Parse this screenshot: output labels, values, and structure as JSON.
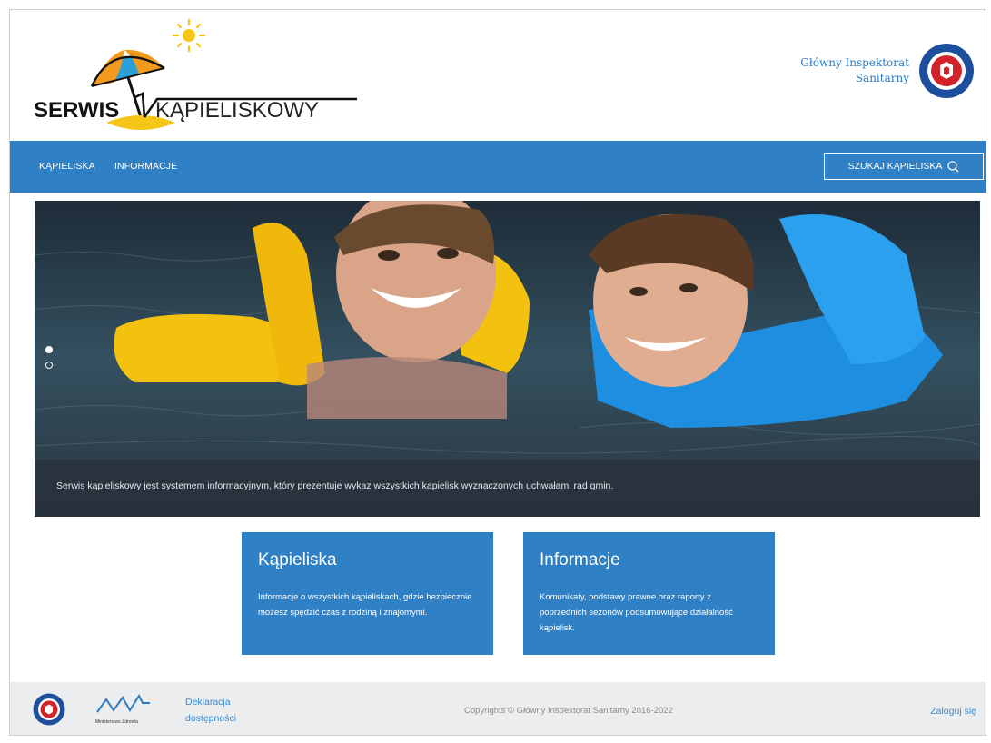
{
  "header": {
    "logo": {
      "bold": "SERWIS",
      "light": "KĄPIELISKOWY"
    },
    "gis": {
      "line1": "Główny Inspektorat",
      "line2": "Sanitarny"
    }
  },
  "nav": {
    "items": [
      {
        "label": "KĄPIELISKA"
      },
      {
        "label": "INFORMACJE"
      }
    ],
    "search_label": "SZUKAJ KĄPIELISKA"
  },
  "hero": {
    "caption": "Serwis kąpieliskowy jest systemem informacyjnym, który prezentuje wykaz wszystkich kąpielisk wyznaczonych uchwałami rad gmin.",
    "slides": {
      "count": 2,
      "active": 1
    }
  },
  "cards": [
    {
      "title": "Kąpieliska",
      "description": "Informacje o wszystkich kąpieliskach, gdzie bezpiecznie możesz spędzić czas z rodziną i znajomymi."
    },
    {
      "title": "Informacje",
      "description": "Komunikaty, podstawy prawne oraz raporty z poprzednich sezonów podsumowujące działalność kąpielisk."
    }
  ],
  "footer": {
    "ministry_label": "Ministerstwo Zdrowia",
    "declaration": {
      "line1": "Deklaracja",
      "line2": "dostępności"
    },
    "copyright": "Copyrights © Główny Inspektorat Sanitarny 2016-2022",
    "login": "Zaloguj się"
  },
  "colors": {
    "brand_blue": "#2f80c4",
    "link_blue": "#3a8ad0",
    "footer_bg": "#ebedef",
    "umbrella_orange": "#f39a1e",
    "umbrella_blue": "#2b9fd8",
    "sun_yellow": "#f5c518"
  },
  "icons": [
    "umbrella-logo-icon",
    "sun-icon",
    "gis-seal-icon",
    "search-icon",
    "ministry-logo-icon"
  ]
}
